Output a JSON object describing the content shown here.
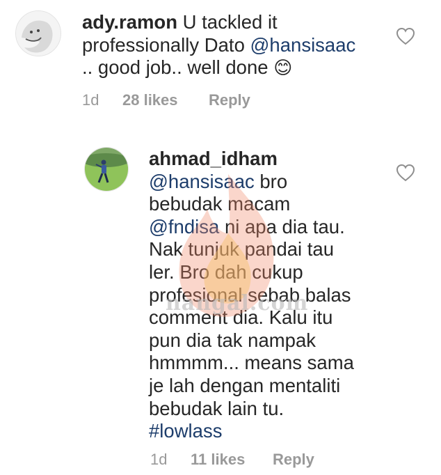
{
  "comments": [
    {
      "username": "ady.ramon",
      "lines": [
        [
          "U tackled it"
        ],
        [
          "professionally Dato ",
          "@hansisaac"
        ],
        [
          ".. good job.. well done "
        ]
      ],
      "emoji": "😊",
      "time": "1d",
      "likes": "28 likes",
      "reply": "Reply"
    },
    {
      "username": "ahmad_idham",
      "lines": [
        "@hansisaac",
        " bro",
        "bebudak macam",
        "@fndisa",
        " ni apa dia tau.",
        "Nak tunjuk pandai tau",
        "ler. Bro dah cukup",
        "profesional sebab balas",
        "comment dia. Kalu itu",
        "pun dia tak nampak",
        "hmmmm... means sama",
        "je lah dengan mentaliti",
        "bebudak lain tu.",
        "#lowlass"
      ],
      "time": "1d",
      "likes": "11 likes",
      "reply": "Reply"
    }
  ],
  "icons": {
    "like": "heart-outline-icon"
  },
  "watermark": {
    "text": "nangal.com"
  },
  "colors": {
    "text": "#262626",
    "link": "#1d3d6b",
    "meta": "#999999"
  }
}
